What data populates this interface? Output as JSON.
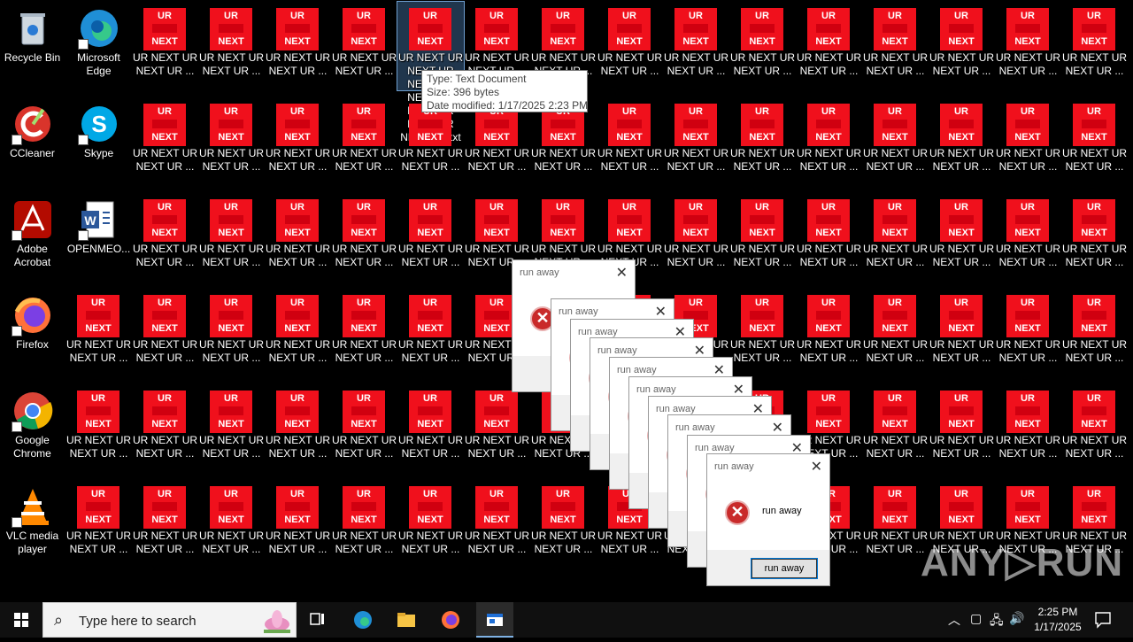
{
  "desktop": {
    "system_icons": [
      {
        "label": "Recycle Bin",
        "icon": "recycle-bin-icon"
      },
      {
        "label": "Microsoft\nEdge",
        "icon": "edge-icon"
      },
      {
        "label": "CCleaner",
        "icon": "ccleaner-icon"
      },
      {
        "label": "Skype",
        "icon": "skype-icon"
      },
      {
        "label": "Adobe\nAcrobat",
        "icon": "acrobat-icon"
      },
      {
        "label": "OPENMEO...",
        "icon": "word-document-icon"
      },
      {
        "label": "Firefox",
        "icon": "firefox-icon"
      },
      {
        "label": "Google\nChrome",
        "icon": "chrome-icon"
      },
      {
        "label": "VLC media\nplayer",
        "icon": "vlc-icon"
      }
    ],
    "ur_file": {
      "tile_top": "UR",
      "tile_bottom": "NEXT",
      "label": "UR NEXT UR\nNEXT UR ...",
      "selected_label": "UR NEXT UR\nNEXT UR\nNEXT UR\nNEXT UR\nNEXT UR\nNEXT UR\nNEXT UR.txt",
      "icon": "ur-next-file-icon"
    }
  },
  "tooltip": {
    "type": "Type: Text Document",
    "size": "Size: 396 bytes",
    "modified": "Date modified: 1/17/2025 2:23 PM"
  },
  "dialog": {
    "title": "run away",
    "message": "run away",
    "button": "run away",
    "close": "✕",
    "icon": "error-icon"
  },
  "watermark": "ANY▷RUN",
  "taskbar": {
    "search_placeholder": "Type here to search",
    "pinned": [
      "task-view-icon",
      "edge-icon",
      "file-explorer-icon",
      "firefox-icon",
      "active-app-icon"
    ],
    "time": "2:25 PM",
    "date": "1/17/2025",
    "colors": {
      "taskbar": "#101010",
      "accent": "#0078d7"
    }
  },
  "colors": {
    "ur_tile": "#f0101c",
    "dialog_bg": "#f0f0f0",
    "error": "#c92a2a"
  }
}
